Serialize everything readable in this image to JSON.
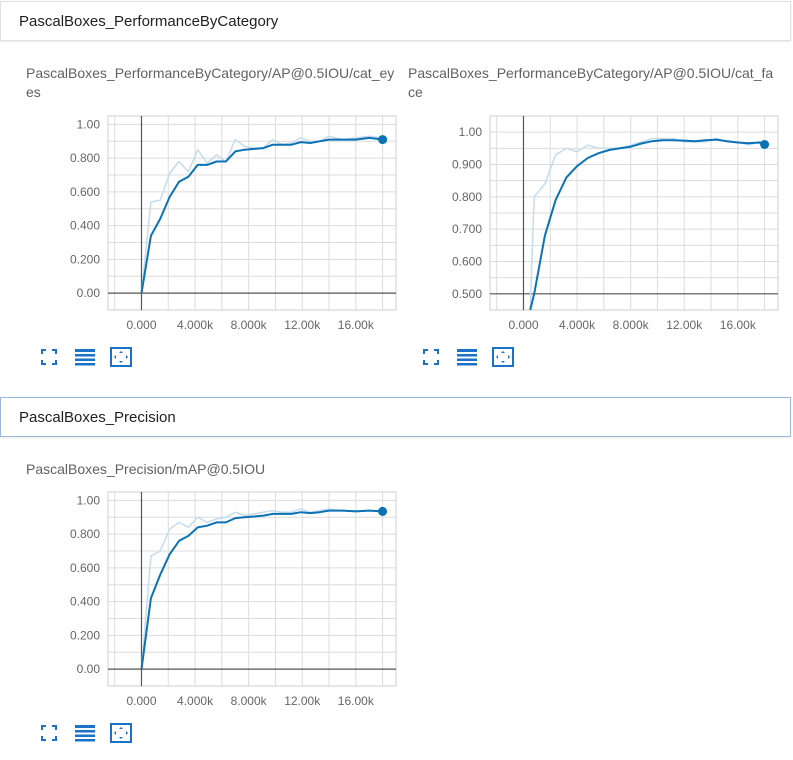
{
  "sections": [
    {
      "title": "PascalBoxes_PerformanceByCategory"
    },
    {
      "title": "PascalBoxes_Precision"
    }
  ],
  "cards": [
    {
      "title": "PascalBoxes_PerformanceByCategory/AP@0.5IOU/cat_eyes",
      "tools": {
        "expand": "expand-icon",
        "data": "toggle-data-icon",
        "fit": "fit-domain-icon"
      }
    },
    {
      "title": "PascalBoxes_PerformanceByCategory/AP@0.5IOU/cat_face",
      "tools": {
        "expand": "expand-icon",
        "data": "toggle-data-icon",
        "fit": "fit-domain-icon"
      }
    },
    {
      "title": "PascalBoxes_Precision/mAP@0.5IOU",
      "tools": {
        "expand": "expand-icon",
        "data": "toggle-data-icon",
        "fit": "fit-domain-icon"
      }
    }
  ],
  "colors": {
    "smoothed": "#0b72b5",
    "raw": "#c5dcec",
    "grid": "#dcdcdc",
    "axis": "#555555",
    "tick": "#666666",
    "icon": "#1a73c9"
  },
  "chart_data": [
    {
      "type": "line",
      "title": "PascalBoxes_PerformanceByCategory/AP@0.5IOU/cat_eyes",
      "xlim": [
        -2500,
        19000
      ],
      "ylim": [
        -0.1,
        1.05
      ],
      "xticks": [
        0,
        4000,
        8000,
        12000,
        16000
      ],
      "xtick_labels": [
        "0.000",
        "4.000k",
        "8.000k",
        "12.00k",
        "16.00k"
      ],
      "yticks": [
        0,
        0.2,
        0.4,
        0.6,
        0.8,
        1.0
      ],
      "ytick_labels": [
        "0.00",
        "0.200",
        "0.400",
        "0.600",
        "0.800",
        "1.00"
      ],
      "grid": true,
      "series": [
        {
          "role": "raw",
          "x": [
            0,
            700,
            1400,
            2100,
            2800,
            3500,
            4200,
            4900,
            5600,
            6300,
            7000,
            7700,
            8400,
            9100,
            9800,
            10500,
            11200,
            11900,
            12600,
            13300,
            14000,
            15000,
            16000,
            17000,
            18000
          ],
          "y": [
            0,
            0.54,
            0.55,
            0.71,
            0.78,
            0.72,
            0.85,
            0.77,
            0.82,
            0.78,
            0.91,
            0.87,
            0.86,
            0.86,
            0.91,
            0.88,
            0.89,
            0.92,
            0.9,
            0.9,
            0.93,
            0.91,
            0.92,
            0.93,
            0.92
          ]
        },
        {
          "role": "smoothed",
          "x": [
            0,
            700,
            1400,
            2100,
            2800,
            3500,
            4200,
            4900,
            5600,
            6300,
            7000,
            7700,
            8400,
            9100,
            9800,
            10500,
            11200,
            11900,
            12600,
            13300,
            14000,
            15000,
            16000,
            17000,
            18000
          ],
          "y": [
            0,
            0.34,
            0.44,
            0.57,
            0.66,
            0.69,
            0.76,
            0.76,
            0.78,
            0.78,
            0.84,
            0.85,
            0.855,
            0.86,
            0.88,
            0.88,
            0.88,
            0.895,
            0.89,
            0.9,
            0.91,
            0.91,
            0.91,
            0.92,
            0.91
          ]
        }
      ]
    },
    {
      "type": "line",
      "title": "PascalBoxes_PerformanceByCategory/AP@0.5IOU/cat_face",
      "xlim": [
        -2500,
        19000
      ],
      "ylim": [
        0.45,
        1.05
      ],
      "xticks": [
        0,
        4000,
        8000,
        12000,
        16000
      ],
      "xtick_labels": [
        "0.000",
        "4.000k",
        "8.000k",
        "12.00k",
        "16.00k"
      ],
      "yticks": [
        0.5,
        0.6,
        0.7,
        0.8,
        0.9,
        1.0
      ],
      "ytick_labels": [
        "0.500",
        "0.600",
        "0.700",
        "0.800",
        "0.900",
        "1.00"
      ],
      "grid": true,
      "series": [
        {
          "role": "raw",
          "x": [
            500,
            800,
            1600,
            2400,
            3200,
            4000,
            4800,
            5600,
            6400,
            7200,
            8000,
            8800,
            9600,
            10400,
            11200,
            12000,
            12800,
            13600,
            14400,
            15200,
            16000,
            16800,
            17600,
            18000
          ],
          "y": [
            0.45,
            0.8,
            0.84,
            0.93,
            0.95,
            0.94,
            0.96,
            0.95,
            0.95,
            0.95,
            0.96,
            0.97,
            0.98,
            0.98,
            0.98,
            0.97,
            0.97,
            0.97,
            0.98,
            0.97,
            0.97,
            0.96,
            0.97,
            0.97
          ]
        },
        {
          "role": "smoothed",
          "x": [
            500,
            800,
            1600,
            2400,
            3200,
            4000,
            4800,
            5600,
            6400,
            7200,
            8000,
            8800,
            9600,
            10400,
            11200,
            12000,
            12800,
            13600,
            14400,
            15200,
            16000,
            16800,
            17600,
            18000
          ],
          "y": [
            0.45,
            0.5,
            0.68,
            0.79,
            0.86,
            0.895,
            0.92,
            0.935,
            0.945,
            0.95,
            0.955,
            0.965,
            0.972,
            0.975,
            0.975,
            0.974,
            0.972,
            0.975,
            0.977,
            0.972,
            0.968,
            0.966,
            0.968,
            0.962
          ]
        }
      ]
    },
    {
      "type": "line",
      "title": "PascalBoxes_Precision/mAP@0.5IOU",
      "xlim": [
        -2500,
        19000
      ],
      "ylim": [
        -0.1,
        1.05
      ],
      "xticks": [
        0,
        4000,
        8000,
        12000,
        16000
      ],
      "xtick_labels": [
        "0.000",
        "4.000k",
        "8.000k",
        "12.00k",
        "16.00k"
      ],
      "yticks": [
        0,
        0.2,
        0.4,
        0.6,
        0.8,
        1.0
      ],
      "ytick_labels": [
        "0.00",
        "0.200",
        "0.400",
        "0.600",
        "0.800",
        "1.00"
      ],
      "grid": true,
      "series": [
        {
          "role": "raw",
          "x": [
            0,
            700,
            1400,
            2100,
            2800,
            3500,
            4200,
            4900,
            5600,
            6300,
            7000,
            7700,
            8400,
            9100,
            9800,
            10500,
            11200,
            11900,
            12600,
            13300,
            14000,
            15000,
            16000,
            17000,
            18000
          ],
          "y": [
            0,
            0.67,
            0.7,
            0.83,
            0.87,
            0.84,
            0.9,
            0.87,
            0.89,
            0.9,
            0.93,
            0.91,
            0.92,
            0.93,
            0.94,
            0.93,
            0.93,
            0.95,
            0.93,
            0.94,
            0.95,
            0.94,
            0.94,
            0.94,
            0.94
          ]
        },
        {
          "role": "smoothed",
          "x": [
            0,
            700,
            1400,
            2100,
            2800,
            3500,
            4200,
            4900,
            5600,
            6300,
            7000,
            7700,
            8400,
            9100,
            9800,
            10500,
            11200,
            11900,
            12600,
            13300,
            14000,
            15000,
            16000,
            17000,
            18000
          ],
          "y": [
            0,
            0.42,
            0.56,
            0.68,
            0.76,
            0.79,
            0.84,
            0.85,
            0.87,
            0.87,
            0.895,
            0.9,
            0.905,
            0.91,
            0.92,
            0.92,
            0.92,
            0.93,
            0.925,
            0.93,
            0.94,
            0.94,
            0.935,
            0.94,
            0.935
          ]
        }
      ]
    }
  ]
}
